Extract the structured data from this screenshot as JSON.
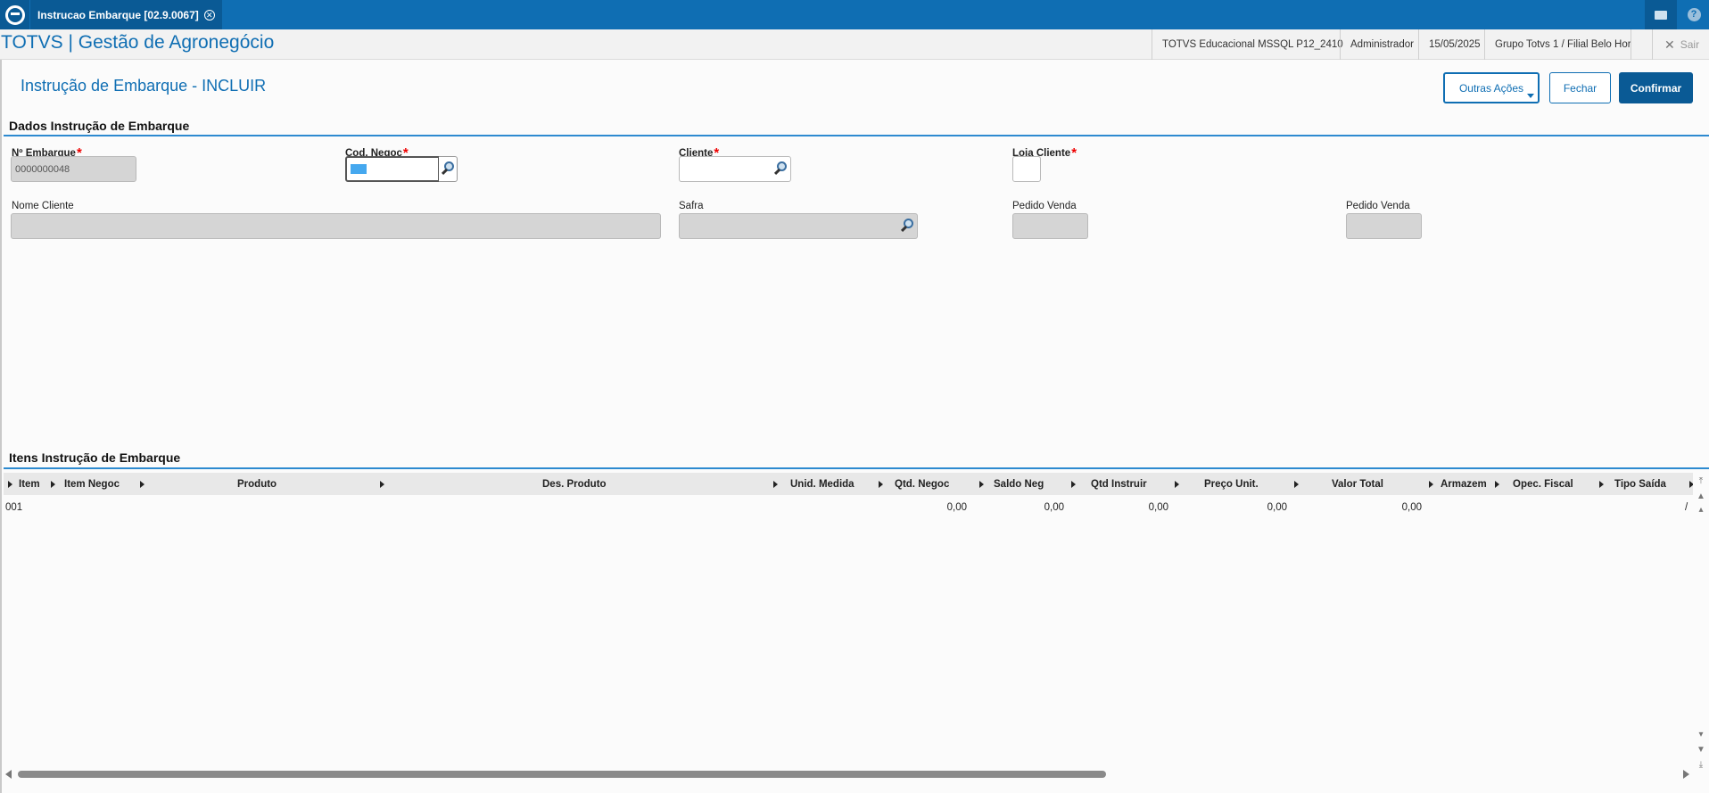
{
  "tab": {
    "title": "Instrucao Embarque [02.9.0067]"
  },
  "header": {
    "app_title": "TOTVS | Gestão de Agronegócio",
    "environment": "TOTVS Educacional MSSQL P12_2410",
    "user": "Administrador",
    "date": "15/05/2025",
    "branch": "Grupo Totvs 1 / Filial Belo Hor",
    "exit_label": "Sair"
  },
  "page": {
    "title": "Instrução de Embarque - INCLUIR"
  },
  "actions": {
    "outras": "Outras Ações",
    "fechar": "Fechar",
    "confirmar": "Confirmar"
  },
  "dados": {
    "section_title": "Dados Instrução de Embarque",
    "n_embarque_label": "Nº Embarque",
    "n_embarque_value": "0000000048",
    "cod_negoc_label": "Cod. Negoc",
    "cliente_label": "Cliente",
    "loja_cliente_label": "Loja Cliente",
    "nome_cliente_label": "Nome Cliente",
    "safra_label": "Safra",
    "pedido_venda_label_1": "Pedido Venda",
    "pedido_venda_label_2": "Pedido Venda"
  },
  "itens": {
    "section_title": "Itens Instrução de Embarque",
    "columns": [
      "Item",
      "Item Negoc",
      "Produto",
      "Des. Produto",
      "Unid. Medida",
      "Qtd. Negoc",
      "Saldo Neg",
      "Qtd Instruir",
      "Preço Unit.",
      "Valor Total",
      "Armazem",
      "Opec. Fiscal",
      "Tipo Saída"
    ],
    "rows": [
      {
        "item": "001",
        "qtd_negoc": "0,00",
        "saldo_neg": "0,00",
        "qtd_instruir": "0,00",
        "preco_unit": "0,00",
        "valor_total": "0,00",
        "tipo_saida": "/"
      }
    ]
  },
  "colors": {
    "brand": "#0f6eb3",
    "brand_dark": "#0a5a95",
    "required": "#ee0000"
  }
}
